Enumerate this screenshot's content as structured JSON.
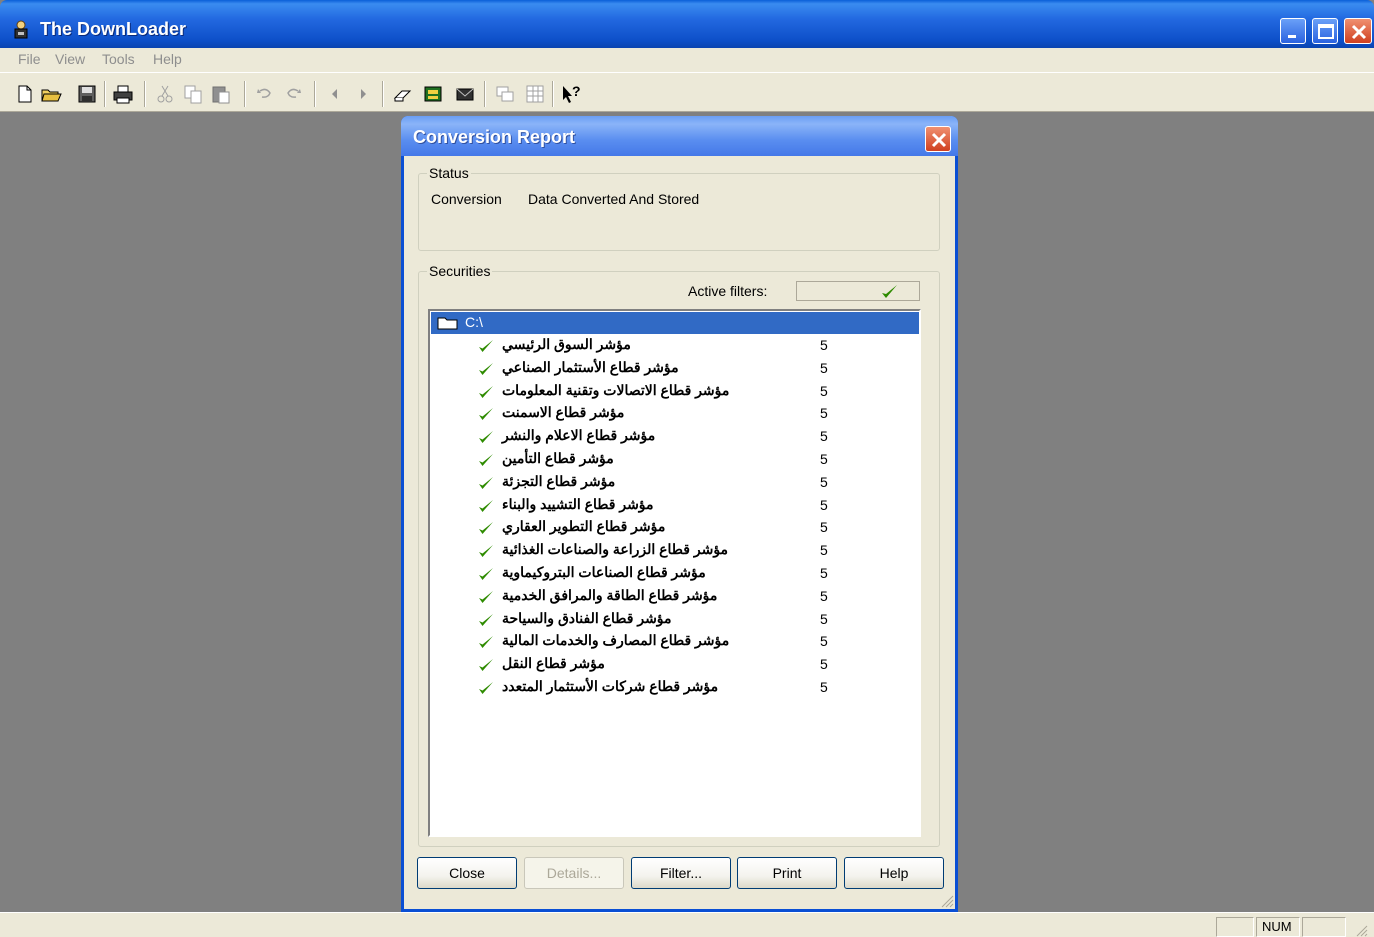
{
  "app": {
    "title": "The DownLoader"
  },
  "menu": [
    "File",
    "View",
    "Tools",
    "Help"
  ],
  "status_bar": {
    "num": "NUM"
  },
  "dialog": {
    "title": "Conversion Report",
    "status_group": {
      "legend": "Status",
      "label": "Conversion",
      "value": "Data Converted And Stored"
    },
    "securities_group": {
      "legend": "Securities",
      "active_filters_label": "Active filters:"
    },
    "tree": {
      "root": "C:\\",
      "items": [
        {
          "name": "مؤشر السوق الرئيسي",
          "count": "5"
        },
        {
          "name": "مؤشر قطاع الأستثمار الصناعي",
          "count": "5"
        },
        {
          "name": "مؤشر قطاع الاتصالات وتقنية المعلومات",
          "count": "5"
        },
        {
          "name": "مؤشر قطاع الاسمنت",
          "count": "5"
        },
        {
          "name": "مؤشر قطاع الاعلام والنشر",
          "count": "5"
        },
        {
          "name": "مؤشر قطاع التأمين",
          "count": "5"
        },
        {
          "name": "مؤشر قطاع التجزئة",
          "count": "5"
        },
        {
          "name": "مؤشر قطاع التشييد والبناء",
          "count": "5"
        },
        {
          "name": "مؤشر قطاع التطوير العقاري",
          "count": "5"
        },
        {
          "name": "مؤشر قطاع الزراعة والصناعات الغذائية",
          "count": "5"
        },
        {
          "name": "مؤشر قطاع الصناعات البتروكيماوية",
          "count": "5"
        },
        {
          "name": "مؤشر قطاع الطاقة والمرافق الخدمية",
          "count": "5"
        },
        {
          "name": "مؤشر قطاع الفنادق والسياحة",
          "count": "5"
        },
        {
          "name": "مؤشر قطاع المصارف والخدمات المالية",
          "count": "5"
        },
        {
          "name": "مؤشر قطاع النقل",
          "count": "5"
        },
        {
          "name": "مؤشر قطاع شركات الأستثمار المتعدد",
          "count": "5"
        }
      ]
    },
    "buttons": {
      "close": "Close",
      "details": "Details...",
      "filter": "Filter...",
      "print": "Print",
      "help": "Help"
    }
  },
  "icons": {
    "app": "downloader-icon",
    "check": "check-icon",
    "folder": "folder-icon"
  },
  "colors": {
    "titlebar": "#0a5fd8",
    "selection": "#316ac5",
    "check": "#2e8b00",
    "workspace": "#808080"
  }
}
